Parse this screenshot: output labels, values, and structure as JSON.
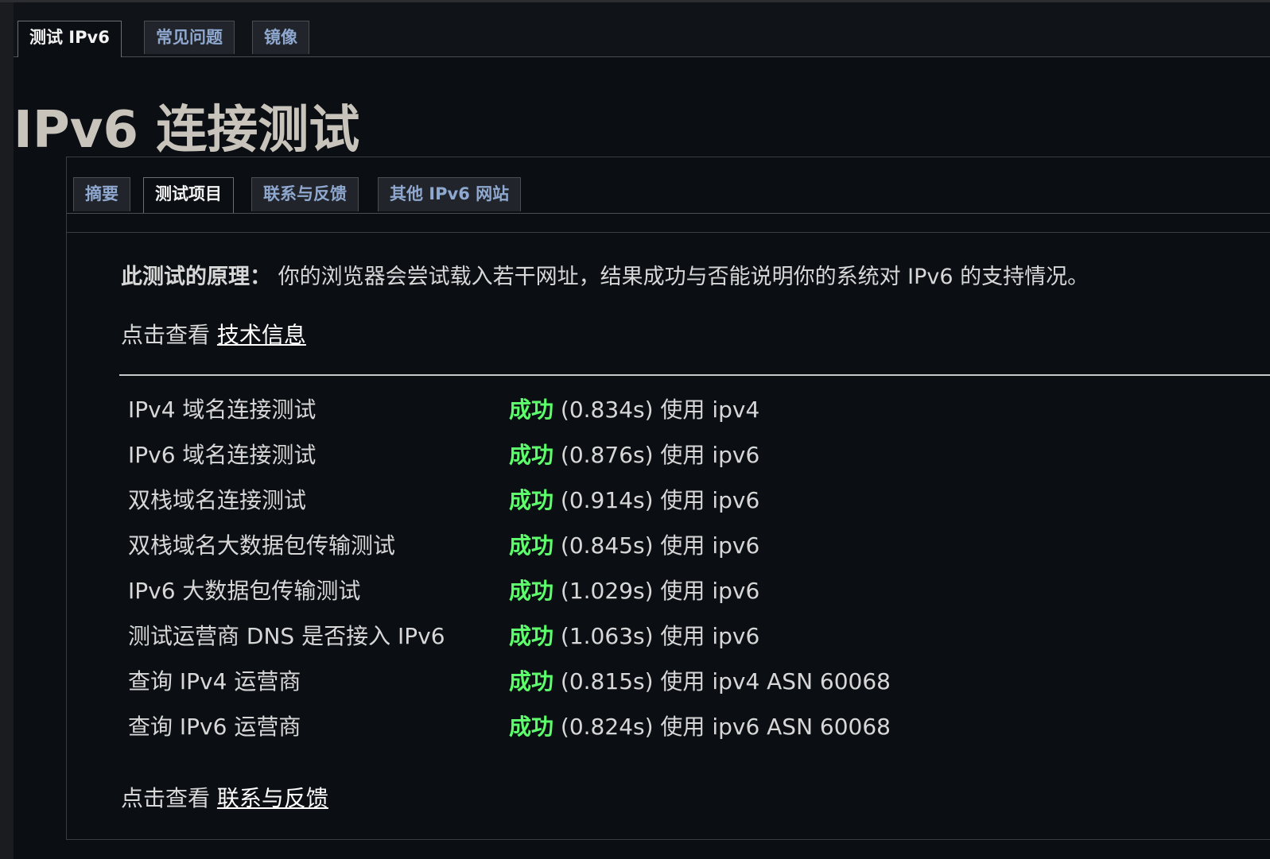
{
  "top_tabs": [
    {
      "label": "测试 IPv6",
      "active": true
    },
    {
      "label": "常见问题",
      "active": false
    },
    {
      "label": "镜像",
      "active": false
    }
  ],
  "page_title": "IPv6 连接测试",
  "sub_tabs": [
    {
      "label": "摘要",
      "active": false
    },
    {
      "label": "测试项目",
      "active": true
    },
    {
      "label": "联系与反馈",
      "active": false
    },
    {
      "label": "其他 IPv6 网站",
      "active": false
    }
  ],
  "principle": {
    "label": "此测试的原理：",
    "text": "你的浏览器会尝试载入若干网址，结果成功与否能说明你的系统对 IPv6 的支持情况。"
  },
  "tech_info": {
    "prefix": "点击查看",
    "link": "技术信息"
  },
  "tests": [
    {
      "name": "IPv4 域名连接测试",
      "status": "成功",
      "detail": "(0.834s) 使用 ipv4"
    },
    {
      "name": "IPv6 域名连接测试",
      "status": "成功",
      "detail": "(0.876s) 使用 ipv6"
    },
    {
      "name": "双栈域名连接测试",
      "status": "成功",
      "detail": "(0.914s) 使用 ipv6"
    },
    {
      "name": "双栈域名大数据包传输测试",
      "status": "成功",
      "detail": "(0.845s) 使用 ipv6"
    },
    {
      "name": "IPv6 大数据包传输测试",
      "status": "成功",
      "detail": "(1.029s) 使用 ipv6"
    },
    {
      "name": "测试运营商 DNS 是否接入 IPv6",
      "status": "成功",
      "detail": "(1.063s) 使用 ipv6"
    },
    {
      "name": "查询 IPv4 运营商",
      "status": "成功",
      "detail": "(0.815s) 使用 ipv4 ASN 60068"
    },
    {
      "name": "查询 IPv6 运营商",
      "status": "成功",
      "detail": "(0.824s) 使用 ipv6 ASN 60068"
    }
  ],
  "feedback": {
    "prefix": "点击查看",
    "link": "联系与反馈"
  },
  "colors": {
    "success": "#5cff6b",
    "tab_link": "#8fa8cf",
    "background": "#0b0e13"
  }
}
